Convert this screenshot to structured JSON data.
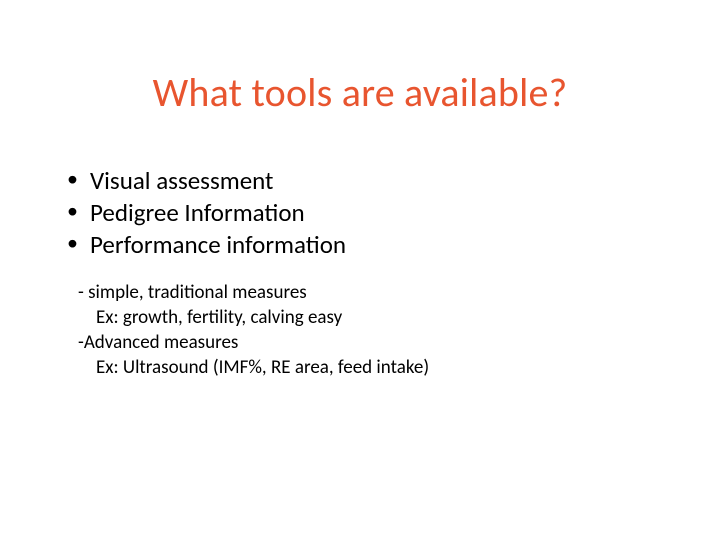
{
  "title": "What tools are available?",
  "bullets": [
    "Visual assessment",
    "Pedigree Information",
    "Performance information"
  ],
  "sub": {
    "l1": "- simple, traditional measures",
    "l2": "Ex: growth, fertility, calving easy",
    "l3": "-Advanced measures",
    "l4": "Ex: Ultrasound (IMF%, RE area, feed intake)"
  }
}
